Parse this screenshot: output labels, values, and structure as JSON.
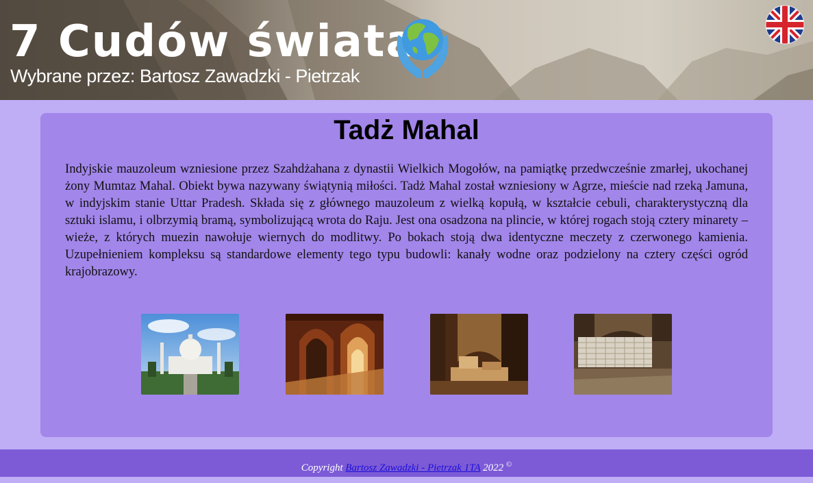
{
  "header": {
    "title": "7 Cudów świata",
    "subtitle": "Wybrane przez: Bartosz Zawadzki - Pietrzak",
    "logo_icon": "globe-hands-icon",
    "language_icon": "uk-flag-icon"
  },
  "card": {
    "title": "Tadż Mahal",
    "text": "Indyjskie mauzoleum wzniesione przez Szahdżahana z dynastii Wielkich Mogołów, na pamiątkę przedwcześnie zmarłej, ukochanej żony Mumtaz Mahal. Obiekt bywa nazywany świątynią miłości. Tadż Mahal został wzniesiony w Agrze, mieście nad rzeką Jamuna, w indyjskim stanie Uttar Pradesh. Składa się z głównego mauzoleum z wielką kopułą, w kształcie cebuli, charakterystyczną dla sztuki islamu, i olbrzymią bramą, symbolizującą wrota do Raju. Jest ona osadzona na plincie, w której rogach stoją cztery minarety – wieże, z których muezin nawołuje wiernych do modlitwy. Po bokach stoją dwa identyczne meczety z czerwonego kamienia. Uzupełnieniem kompleksu są standardowe elementy tego typu budowli: kanały wodne oraz podzielony na cztery części ogród krajobrazowy."
  },
  "gallery": [
    {
      "name": "taj-mahal-exterior-photo"
    },
    {
      "name": "taj-mahal-arches-photo"
    },
    {
      "name": "taj-mahal-tomb-interior-photo"
    },
    {
      "name": "taj-mahal-marble-screen-photo"
    }
  ],
  "footer": {
    "prefix": "Copyright",
    "author_link": "Bartosz Zawadzki - Pietrzak 1TA",
    "year": "2022",
    "symbol": "©"
  },
  "colors": {
    "page_bg": "#bfaef6",
    "card_bg": "#a286ea",
    "footer_bg": "#7d5bd6",
    "link": "#1a0fd8"
  }
}
